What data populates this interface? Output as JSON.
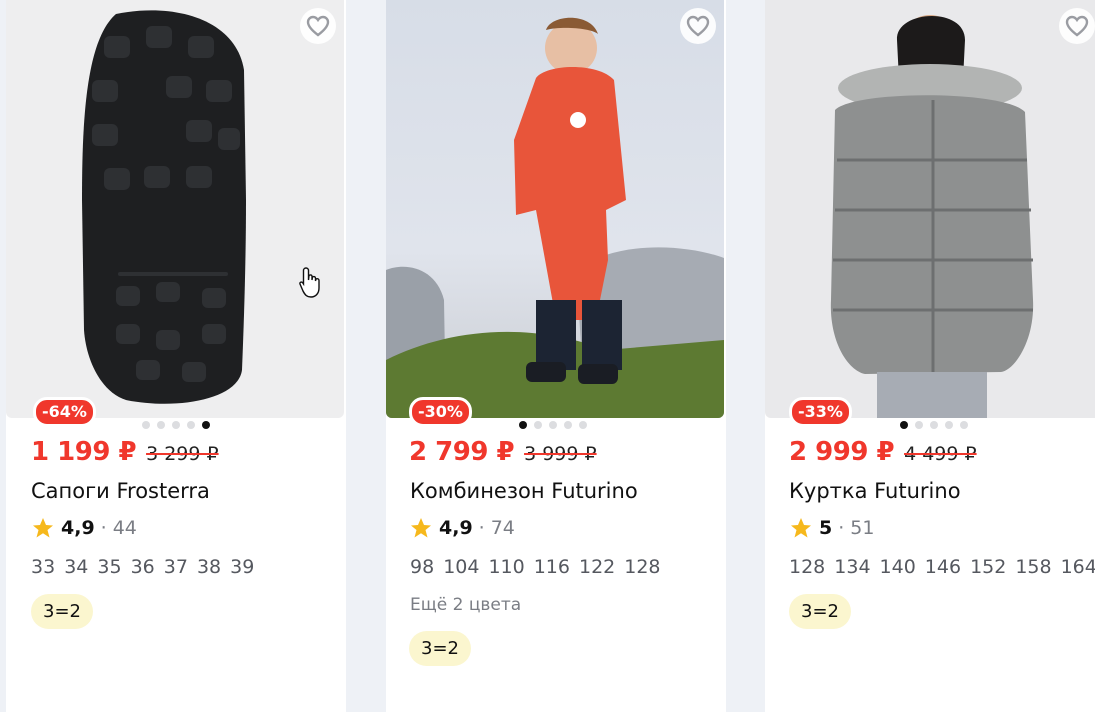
{
  "products": [
    {
      "discount": "-64%",
      "price": "1 199 ₽",
      "old_price": "3 299 ₽",
      "title": "Сапоги Frosterra",
      "rating": "4,9",
      "reviews": "44",
      "sizes": [
        "33",
        "34",
        "35",
        "36",
        "37",
        "38",
        "39"
      ],
      "promo": "3=2"
    },
    {
      "discount": "-30%",
      "price": "2 799 ₽",
      "old_price": "3 999 ₽",
      "title": "Комбинезон Futurino",
      "rating": "4,9",
      "reviews": "74",
      "sizes": [
        "98",
        "104",
        "110",
        "116",
        "122",
        "128"
      ],
      "colors_note": "Ещё 2 цвета",
      "promo": "3=2"
    },
    {
      "discount": "-33%",
      "price": "2 999 ₽",
      "old_price": "4 499 ₽",
      "title": "Куртка Futurino",
      "rating": "5",
      "reviews": "51",
      "sizes": [
        "128",
        "134",
        "140",
        "146",
        "152",
        "158",
        "164"
      ],
      "promo": "3=2"
    }
  ],
  "icons": {
    "favorite": "heart-icon",
    "rating": "star-icon"
  },
  "colors": {
    "accent": "#f0372c",
    "star": "#f6b81c",
    "promo_bg": "#fbf6cf"
  }
}
